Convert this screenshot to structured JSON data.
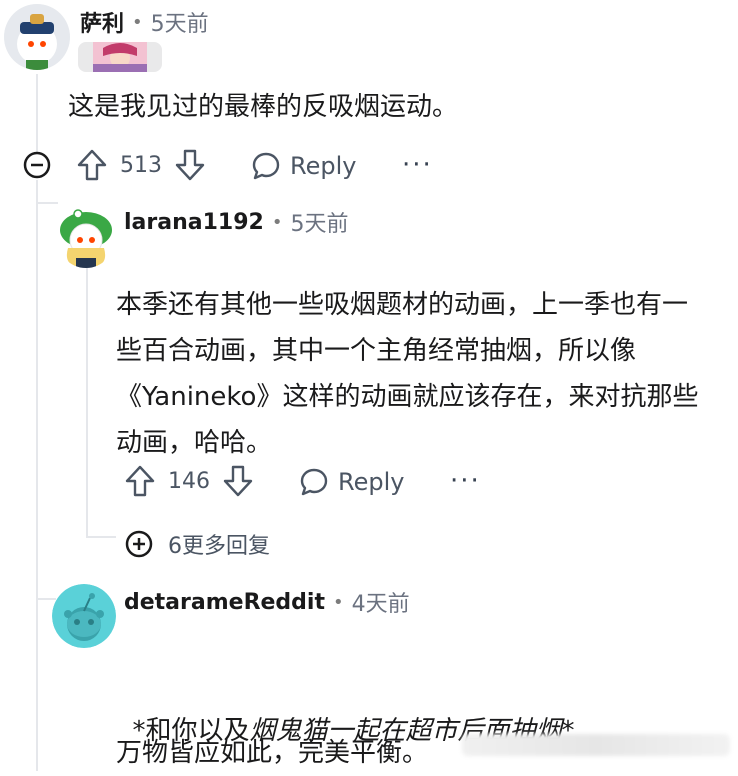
{
  "comments": [
    {
      "username": "萨利",
      "time": "5天前",
      "text": "这是我见过的最棒的反吸烟运动。",
      "votes": "513",
      "reply_label": "Reply",
      "more_label": "···"
    },
    {
      "username": "larana1192",
      "time": "5天前",
      "text": "本季还有其他一些吸烟题材的动画，上一季也有一\n些百合动画，其中一个主角经常抽烟，所以像\n《Yanineko》这样的动画就应该存在，来对抗那些\n动画，哈哈。",
      "votes": "146",
      "reply_label": "Reply",
      "more_label": "···"
    },
    {
      "username": "detarameReddit",
      "time": "4天前",
      "text_a_prefix": "*和你以及",
      "text_a_italic": "烟鬼猫一起在超市后面抽烟*",
      "text_b": "万物皆应如此，完美平衡。"
    }
  ],
  "more_replies": "6更多回复",
  "separator": "•",
  "colors": {
    "avatar_teal": "#5ad1d8",
    "avatar_robot_green": "#38b24a"
  }
}
